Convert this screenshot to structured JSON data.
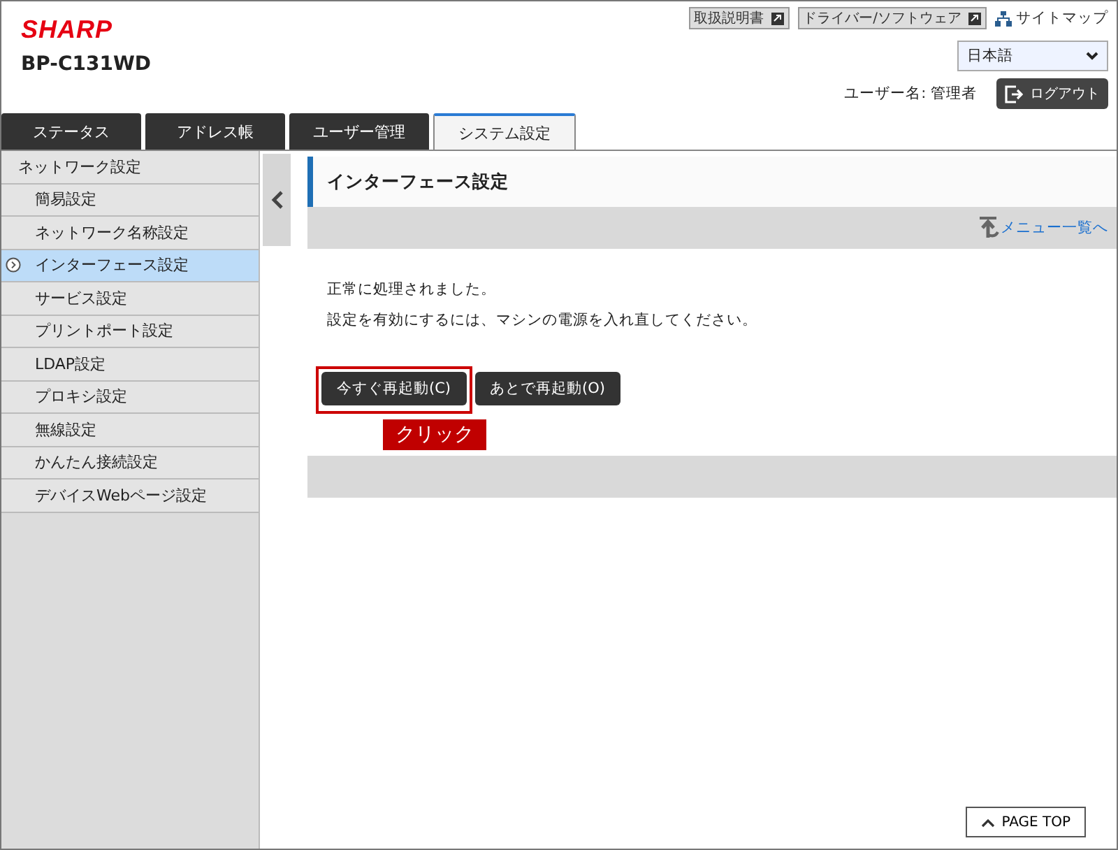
{
  "header": {
    "logo": "SHARP",
    "model": "BP-C131WD",
    "links": [
      {
        "label": "取扱説明書",
        "kind": "external"
      },
      {
        "label": "ドライバー/ソフトウェア",
        "kind": "external"
      },
      {
        "label": "サイトマップ",
        "kind": "sitemap"
      }
    ],
    "language": "日本語",
    "user": "ユーザー名: 管理者",
    "logout": "ログアウト"
  },
  "tabs": [
    {
      "label": "ステータス",
      "selected": false
    },
    {
      "label": "アドレス帳",
      "selected": false
    },
    {
      "label": "ユーザー管理",
      "selected": false
    },
    {
      "label": "システム設定",
      "selected": true
    }
  ],
  "sidebar": {
    "items": [
      {
        "label": "ネットワーク設定",
        "selected": false,
        "children": [
          {
            "label": "簡易設定",
            "selected": false
          },
          {
            "label": "ネットワーク名称設定",
            "selected": false
          },
          {
            "label": "インターフェース設定",
            "selected": true
          },
          {
            "label": "サービス設定",
            "selected": false
          },
          {
            "label": "プリントポート設定",
            "selected": false
          },
          {
            "label": "LDAP設定",
            "selected": false
          },
          {
            "label": "プロキシ設定",
            "selected": false
          },
          {
            "label": "無線設定",
            "selected": false
          },
          {
            "label": "かんたん接続設定",
            "selected": false
          },
          {
            "label": "デバイスWebページ設定",
            "selected": false
          }
        ]
      }
    ]
  },
  "content": {
    "title": "インターフェース設定",
    "menu_link": "メニュー一覧へ",
    "messages": [
      "正常に処理されました。",
      "設定を有効にするには、マシンの電源を入れ直してください。"
    ],
    "buttons": [
      {
        "label": "今すぐ再起動(C)",
        "highlighted": true
      },
      {
        "label": "あとで再起動(O)",
        "highlighted": false
      }
    ],
    "callout": "クリック",
    "page_top": "PAGE TOP"
  }
}
